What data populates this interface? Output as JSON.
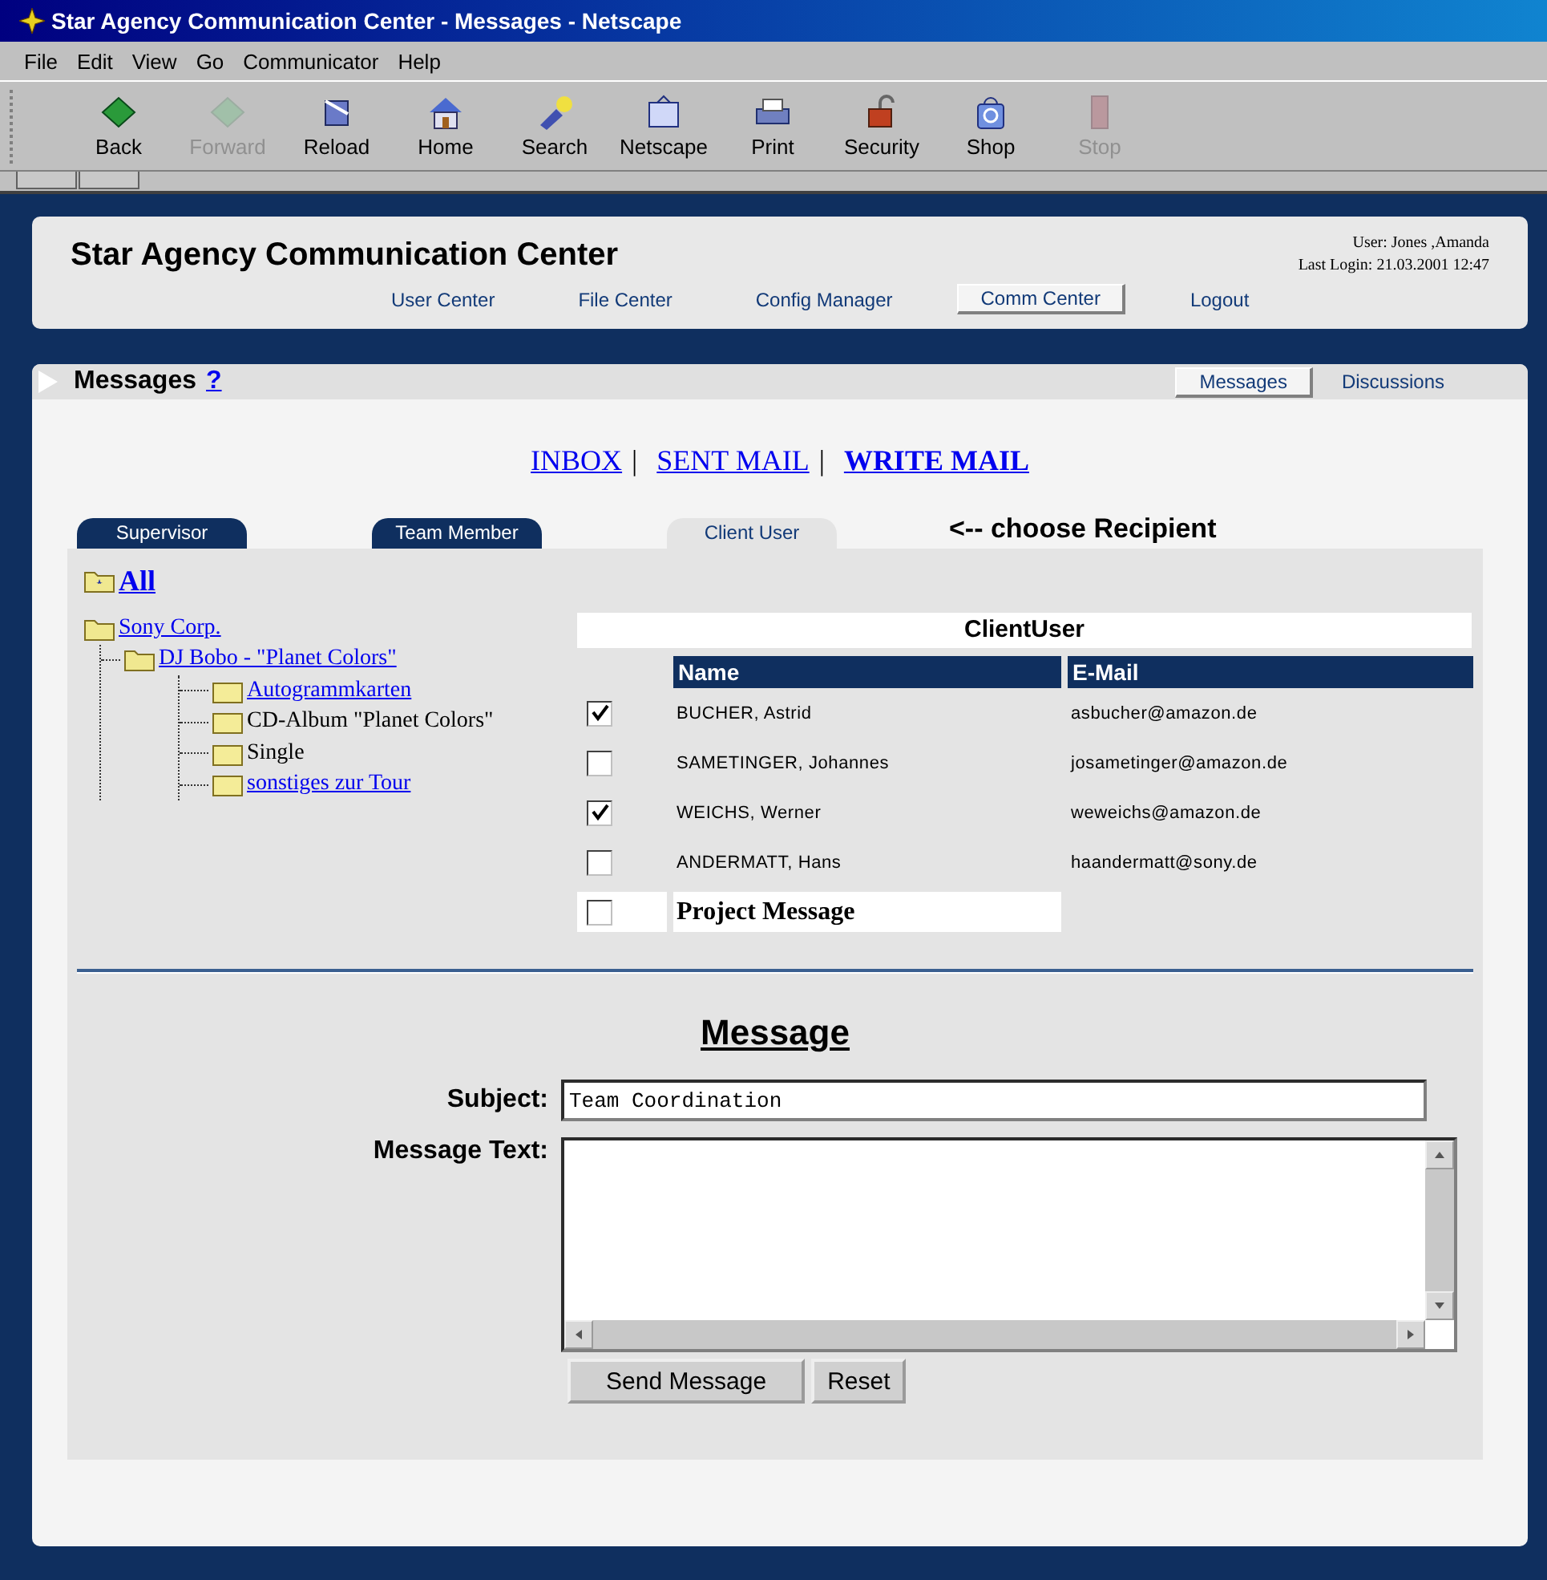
{
  "window": {
    "title": "Star Agency Communication Center - Messages - Netscape"
  },
  "menu": [
    "File",
    "Edit",
    "View",
    "Go",
    "Communicator",
    "Help"
  ],
  "toolbar": [
    {
      "label": "Back",
      "disabled": false
    },
    {
      "label": "Forward",
      "disabled": true
    },
    {
      "label": "Reload",
      "disabled": false
    },
    {
      "label": "Home",
      "disabled": false
    },
    {
      "label": "Search",
      "disabled": false
    },
    {
      "label": "Netscape",
      "disabled": false
    },
    {
      "label": "Print",
      "disabled": false
    },
    {
      "label": "Security",
      "disabled": false
    },
    {
      "label": "Shop",
      "disabled": false
    },
    {
      "label": "Stop",
      "disabled": true
    }
  ],
  "header": {
    "title": "Star Agency Communication Center",
    "user": "User: Jones ,Amanda",
    "last_login": "Last Login: 21.03.2001 12:47",
    "nav": [
      {
        "label": "User Center",
        "selected": false
      },
      {
        "label": "File Center",
        "selected": false
      },
      {
        "label": "Config Manager",
        "selected": false
      },
      {
        "label": "Comm Center",
        "selected": true
      },
      {
        "label": "Logout",
        "selected": false
      }
    ]
  },
  "section": {
    "title": "Messages",
    "help": "?",
    "subnav": [
      {
        "label": "Messages",
        "selected": true
      },
      {
        "label": "Discussions",
        "selected": false
      }
    ]
  },
  "mail_links": [
    {
      "label": "INBOX",
      "separator": "|",
      "selected": false
    },
    {
      "label": "SENT MAIL",
      "separator": "|",
      "selected": false
    },
    {
      "label": "WRITE MAIL",
      "selected": true
    }
  ],
  "recipient_tabs": [
    {
      "label": "Supervisor",
      "selected": false
    },
    {
      "label": "Team Member",
      "selected": false
    },
    {
      "label": "Client User",
      "selected": true
    }
  ],
  "recipient_hint": "<-- choose Recipient",
  "tree": {
    "root": "All",
    "items": [
      {
        "label": "Sony Corp.",
        "link": true,
        "children": [
          {
            "label": "DJ Bobo - \"Planet Colors\"",
            "link": true,
            "children": [
              {
                "label": "Autogrammkarten",
                "link": true
              },
              {
                "label": "CD-Album \"Planet Colors\"",
                "link": false
              },
              {
                "label": "Single",
                "link": false
              },
              {
                "label": "sonstiges zur Tour",
                "link": true
              }
            ]
          }
        ]
      }
    ]
  },
  "table": {
    "title": "ClientUser",
    "columns": [
      "Name",
      "E-Mail"
    ],
    "rows": [
      {
        "name": "BUCHER, Astrid",
        "email": "asbucher@amazon.de",
        "checked": true
      },
      {
        "name": "SAMETINGER, Johannes",
        "email": "josametinger@amazon.de",
        "checked": false
      },
      {
        "name": "WEICHS, Werner",
        "email": "weweichs@amazon.de",
        "checked": true
      },
      {
        "name": "ANDERMATT, Hans",
        "email": "haandermatt@sony.de",
        "checked": false
      }
    ],
    "project": {
      "label": "Project Message",
      "checked": false
    }
  },
  "form": {
    "heading": "Message",
    "subject_label": "Subject:",
    "subject": "Team Coordination",
    "text_label": "Message Text:",
    "buttons": [
      "Send Message",
      "Reset"
    ]
  }
}
